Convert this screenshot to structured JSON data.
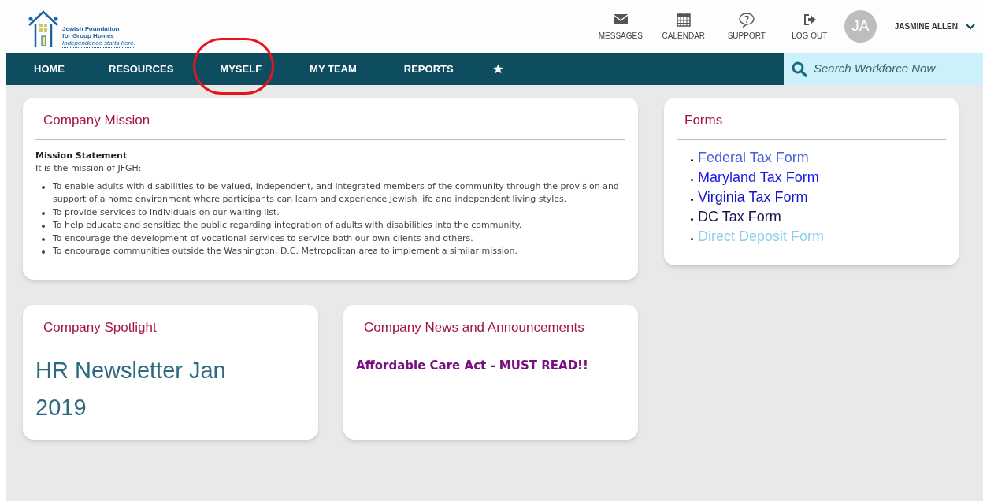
{
  "logo": {
    "name_lines": [
      "Jewish Foundation",
      "for Group Homes"
    ],
    "tagline": "Independence starts here."
  },
  "header_actions": [
    {
      "kind": "messages",
      "label": "MESSAGES"
    },
    {
      "kind": "calendar",
      "label": "CALENDAR"
    },
    {
      "kind": "support",
      "label": "SUPPORT"
    },
    {
      "kind": "logout",
      "label": "LOG OUT"
    }
  ],
  "user": {
    "initials": "JA",
    "name": "JASMINE ALLEN"
  },
  "nav": [
    {
      "kind": "text",
      "label": "HOME",
      "circled": false
    },
    {
      "kind": "text",
      "label": "RESOURCES",
      "circled": false
    },
    {
      "kind": "text",
      "label": "MYSELF",
      "circled": true
    },
    {
      "kind": "text",
      "label": "MY TEAM",
      "circled": false
    },
    {
      "kind": "text",
      "label": "REPORTS",
      "circled": false
    },
    {
      "kind": "star",
      "circled": false
    }
  ],
  "search": {
    "placeholder": "Search Workforce Now"
  },
  "mission": {
    "title": "Company Mission",
    "heading": "Mission Statement",
    "intro": "It is the mission of JFGH:",
    "items": [
      "To enable adults with disabilities to be valued, independent, and integrated members of the community through the provision and support of a home environment where participants can learn and experience Jewish life and independent living styles.",
      "To provide services to individuals on our waiting list.",
      "To help educate and sensitize the public regarding integration of adults with disabilities into the community.",
      "To encourage the development of vocational services to service both our own clients and others.",
      "To encourage communities outside the Washington, D.C. Metropolitan area to implement a similar mission."
    ]
  },
  "forms": {
    "title": "Forms",
    "links": [
      {
        "label": "Federal Tax Form",
        "color": "#4a5fe0"
      },
      {
        "label": "Maryland Tax Form",
        "color": "#1a1ae6"
      },
      {
        "label": "Virginia Tax Form",
        "color": "#1414c8"
      },
      {
        "label": "DC Tax Form",
        "color": "#141450"
      },
      {
        "label": "Direct Deposit Form",
        "color": "#8ccfec"
      }
    ]
  },
  "spotlight": {
    "title": "Company Spotlight",
    "text": "HR Newsletter Jan 2019"
  },
  "news": {
    "title": "Company News and Announcements",
    "items": [
      "Affordable Care Act - MUST READ!!"
    ]
  }
}
